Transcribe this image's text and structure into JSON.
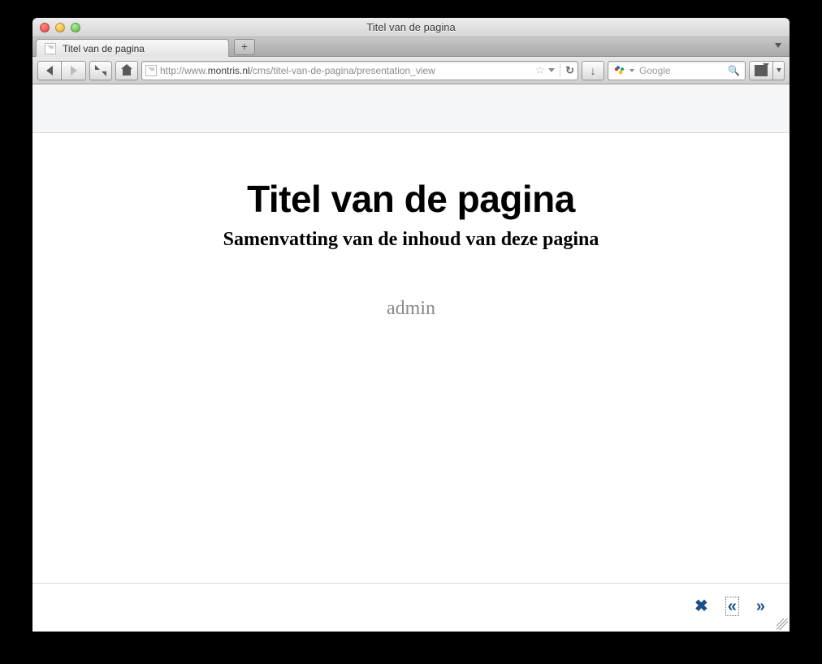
{
  "window": {
    "title": "Titel van de pagina"
  },
  "tabs": [
    {
      "label": "Titel van de pagina"
    }
  ],
  "url": {
    "prefix": "http://www.",
    "host": "montris.nl",
    "path": "/cms/titel-van-de-pagina/presentation_view"
  },
  "search": {
    "placeholder": "Google"
  },
  "page": {
    "heading": "Titel van de pagina",
    "subheading": "Samenvatting van de inhoud van deze pagina",
    "author": "admin"
  },
  "controls": {
    "close_glyph": "✖",
    "prev_glyph": "«",
    "next_glyph": "»"
  },
  "toolbar": {
    "newtab_glyph": "+",
    "reload_glyph": "↻",
    "download_glyph": "↓",
    "star_glyph": "☆",
    "magnifier_glyph": "🔍"
  }
}
